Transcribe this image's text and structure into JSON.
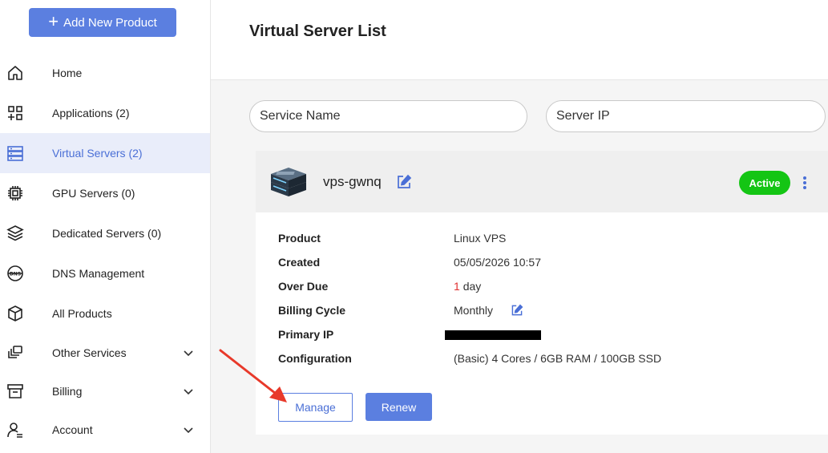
{
  "sidebar": {
    "add_button_label": "Add New Product",
    "items": [
      {
        "label": "Home"
      },
      {
        "label": "Applications (2)"
      },
      {
        "label": "Virtual Servers (2)"
      },
      {
        "label": "GPU Servers (0)"
      },
      {
        "label": "Dedicated Servers (0)"
      },
      {
        "label": "DNS Management"
      },
      {
        "label": "All Products"
      },
      {
        "label": "Other Services"
      },
      {
        "label": "Billing"
      },
      {
        "label": "Account"
      }
    ]
  },
  "header": {
    "title": "Virtual Server List"
  },
  "filters": {
    "service_name_placeholder": "Service Name",
    "server_ip_placeholder": "Server IP"
  },
  "card": {
    "name": "vps-gwnq",
    "status": "Active",
    "rows": {
      "product_label": "Product",
      "product_value": "Linux VPS",
      "created_label": "Created",
      "created_value": "05/05/2026 10:57",
      "overdue_label": "Over Due",
      "overdue_number": "1",
      "overdue_unit": "day",
      "billing_label": "Billing Cycle",
      "billing_value": "Monthly",
      "ip_label": "Primary IP",
      "config_label": "Configuration",
      "config_value": "(Basic) 4 Cores / 6GB RAM / 100GB SSD"
    },
    "manage_label": "Manage",
    "renew_label": "Renew"
  },
  "colors": {
    "accent": "#5b7fe0",
    "active_bg": "#e9edfa",
    "status_green": "#14c514",
    "overdue_red": "#e03030",
    "annotation_arrow": "#e8392a"
  }
}
